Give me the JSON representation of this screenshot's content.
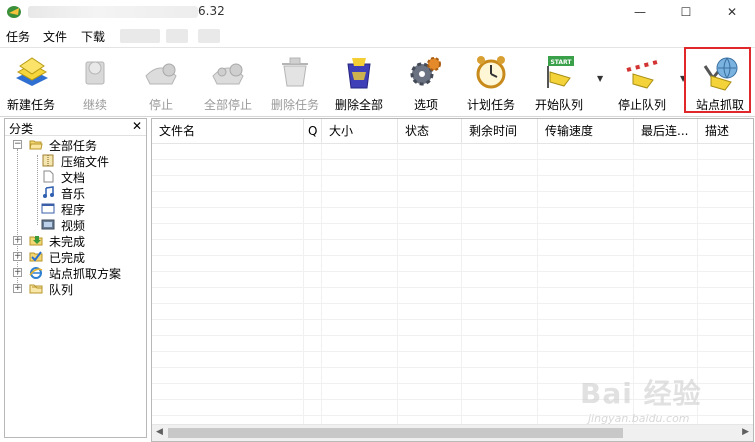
{
  "window": {
    "title_version": "6.32",
    "minimize": "—",
    "maximize": "☐",
    "close": "✕"
  },
  "menu": [
    "任务",
    "文件",
    "下载"
  ],
  "toolbar": [
    {
      "label": "新建任务",
      "icon": "new-task-icon",
      "enabled": true
    },
    {
      "label": "继续",
      "icon": "resume-icon",
      "enabled": false
    },
    {
      "label": "停止",
      "icon": "stop-icon",
      "enabled": false
    },
    {
      "label": "全部停止",
      "icon": "stop-all-icon",
      "enabled": false
    },
    {
      "label": "删除任务",
      "icon": "delete-task-icon",
      "enabled": false
    },
    {
      "label": "删除全部",
      "icon": "delete-all-icon",
      "enabled": true
    },
    {
      "label": "选项",
      "icon": "options-gear-icon",
      "enabled": true
    },
    {
      "label": "计划任务",
      "icon": "scheduler-clock-icon",
      "enabled": true
    },
    {
      "label": "开始队列",
      "icon": "start-queue-icon",
      "enabled": true
    },
    {
      "label": "停止队列",
      "icon": "stop-queue-icon",
      "enabled": true
    },
    {
      "label": "站点抓取",
      "icon": "site-grabber-icon",
      "enabled": true
    }
  ],
  "toolbar_start_sign": "START",
  "highlight_color": "#e0282b",
  "left_panel": {
    "title": "分类",
    "close": "✕",
    "tree": [
      {
        "label": "全部任务",
        "icon": "open-folder-icon",
        "level": 0,
        "expander": "−"
      },
      {
        "label": "压缩文件",
        "icon": "archive-icon",
        "level": 1
      },
      {
        "label": "文档",
        "icon": "document-icon",
        "level": 1
      },
      {
        "label": "音乐",
        "icon": "music-note-icon",
        "level": 1
      },
      {
        "label": "程序",
        "icon": "program-window-icon",
        "level": 1
      },
      {
        "label": "视频",
        "icon": "video-icon",
        "level": 1
      },
      {
        "label": "未完成",
        "icon": "incomplete-folder-icon",
        "level": 0,
        "expander": "+"
      },
      {
        "label": "已完成",
        "icon": "completed-folder-icon",
        "level": 0,
        "expander": "+"
      },
      {
        "label": "站点抓取方案",
        "icon": "ie-globe-icon",
        "level": 0,
        "expander": "+"
      },
      {
        "label": "队列",
        "icon": "queue-folder-icon",
        "level": 0,
        "expander": "+"
      }
    ]
  },
  "list": {
    "columns": [
      "文件名",
      "Q",
      "大小",
      "状态",
      "剩余时间",
      "传输速度",
      "最后连...",
      "描述"
    ],
    "rows": []
  },
  "scroll": {
    "left": "◀",
    "right": "▶"
  },
  "watermark": {
    "text": "Bai 经验",
    "url": "jingyan.baidu.com"
  }
}
